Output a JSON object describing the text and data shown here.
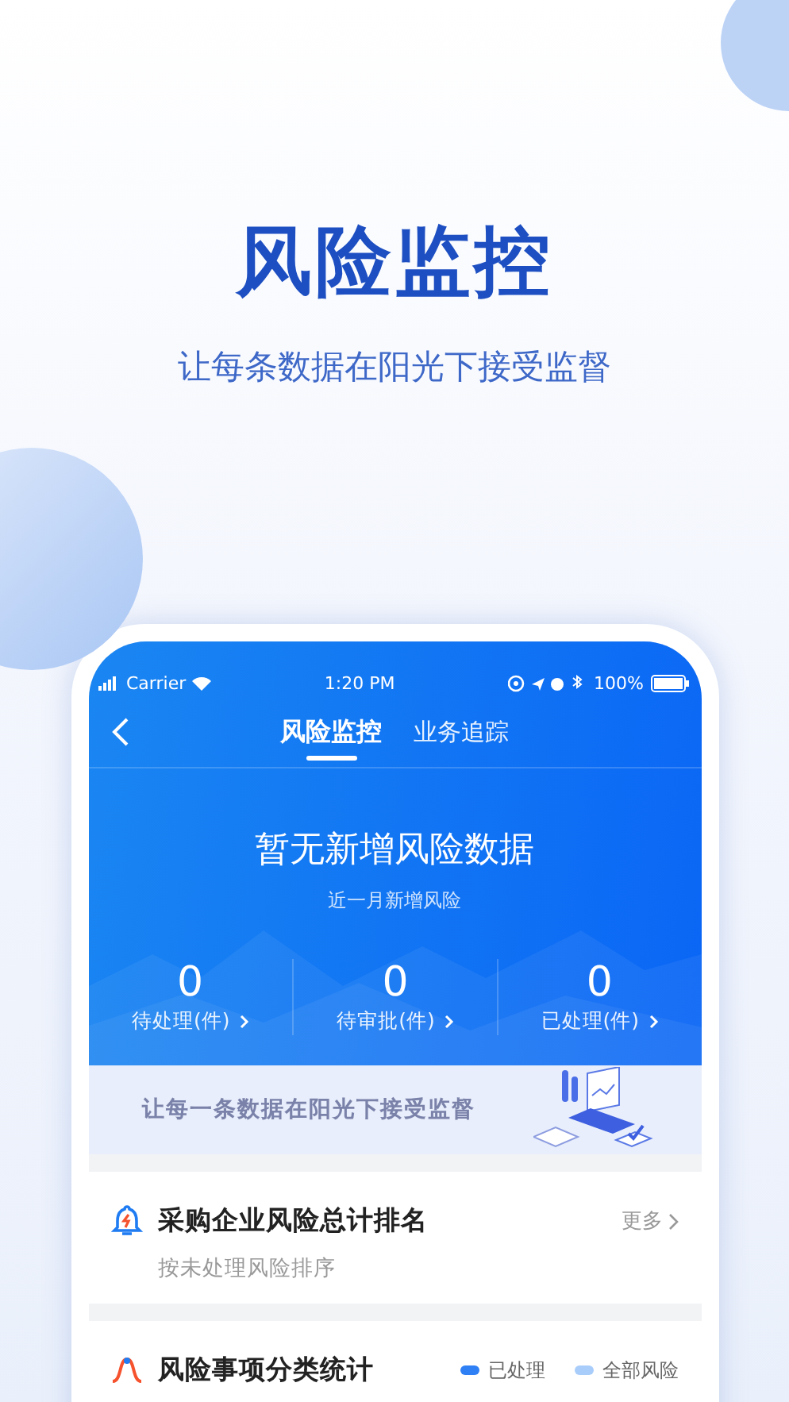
{
  "hero": {
    "title": "风险监控",
    "subtitle": "让每条数据在阳光下接受监督"
  },
  "status_bar": {
    "carrier": "Carrier",
    "time": "1:20 PM",
    "battery": "100%"
  },
  "nav": {
    "tabs": [
      {
        "label": "风险监控",
        "selected": true
      },
      {
        "label": "业务追踪",
        "selected": false
      }
    ]
  },
  "summary": {
    "title": "暂无新增风险数据",
    "subtitle": "近一月新增风险",
    "stats": [
      {
        "value": "0",
        "label": "待处理(件)"
      },
      {
        "value": "0",
        "label": "待审批(件)"
      },
      {
        "value": "0",
        "label": "已处理(件)"
      }
    ]
  },
  "banner": {
    "text": "让每一条数据在阳光下接受监督"
  },
  "sections": [
    {
      "kind": "ranking",
      "title": "采购企业风险总计排名",
      "more": "更多",
      "subtitle": "按未处理风险排序"
    },
    {
      "kind": "chart",
      "title": "风险事项分类统计",
      "legend": [
        {
          "label": "已处理",
          "color": "#2f7ff5"
        },
        {
          "label": "全部风险",
          "color": "#a9cdfb"
        }
      ]
    }
  ]
}
